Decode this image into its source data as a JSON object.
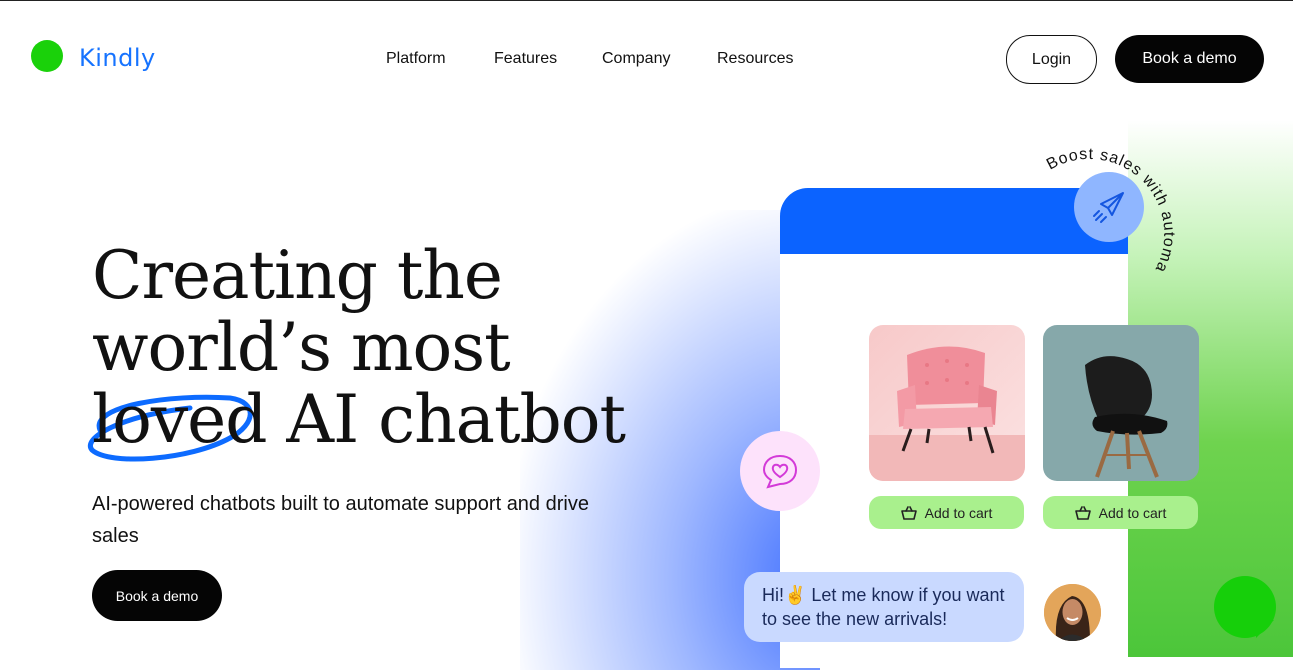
{
  "brand": {
    "name": "Kindly",
    "logo_color": "#1ad10a",
    "text_color": "#1673ff"
  },
  "nav": {
    "items": [
      {
        "label": "Platform"
      },
      {
        "label": "Features"
      },
      {
        "label": "Company"
      },
      {
        "label": "Resources"
      }
    ],
    "login_label": "Login",
    "demo_label": "Book a demo"
  },
  "hero": {
    "headline_line1": "Creating the",
    "headline_line2": "world’s most",
    "headline_word_loved": "loved",
    "headline_line3_rest": " AI chatbot",
    "subtitle": "AI-powered chatbots built to automate support and drive sales",
    "cta_label": "Book a demo"
  },
  "mockup": {
    "badge_text": "Boost sales with automation",
    "products": [
      {
        "name": "pink-armchair",
        "add_label": "Add to cart"
      },
      {
        "name": "black-chair",
        "add_label": "Add to cart"
      }
    ],
    "chat_message": "Hi!✌️ Let me know if you want to see the new arrivals!",
    "colors": {
      "header": "#0b63ff",
      "cart_button": "#a9f08d",
      "bubble": "#c9d9ff",
      "launcher": "#16cf0a"
    }
  }
}
